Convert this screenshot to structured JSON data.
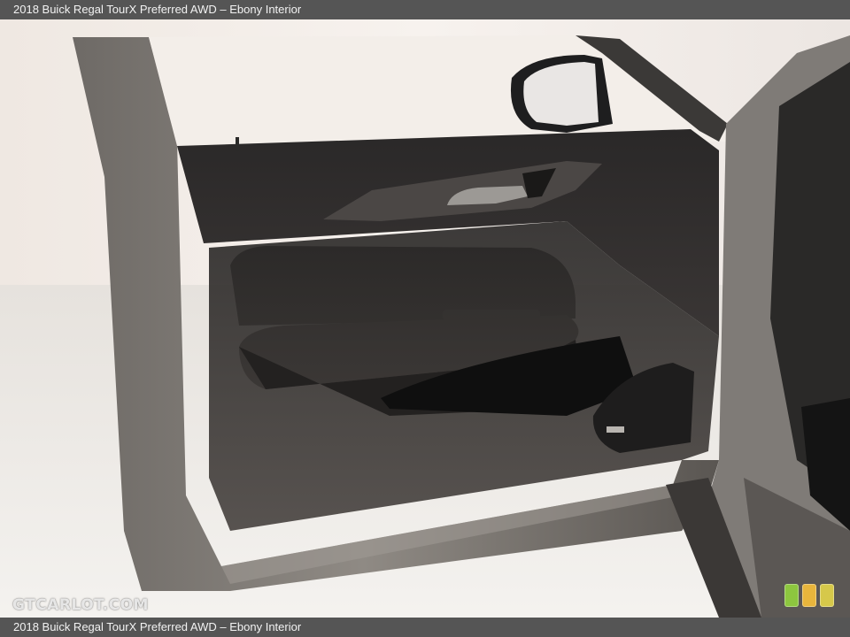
{
  "caption": {
    "top": "2018 Buick Regal TourX Preferred AWD – Ebony Interior",
    "bottom": "2018 Buick Regal TourX Preferred AWD – Ebony Interior"
  },
  "photo": {
    "subject": "driver-door-interior-panel"
  },
  "watermark": {
    "text": "GTCARLOT.COM"
  },
  "rating_badges": [
    {
      "color": "#8dc63f"
    },
    {
      "color": "#e8b53c"
    },
    {
      "color": "#d6c84a"
    }
  ]
}
